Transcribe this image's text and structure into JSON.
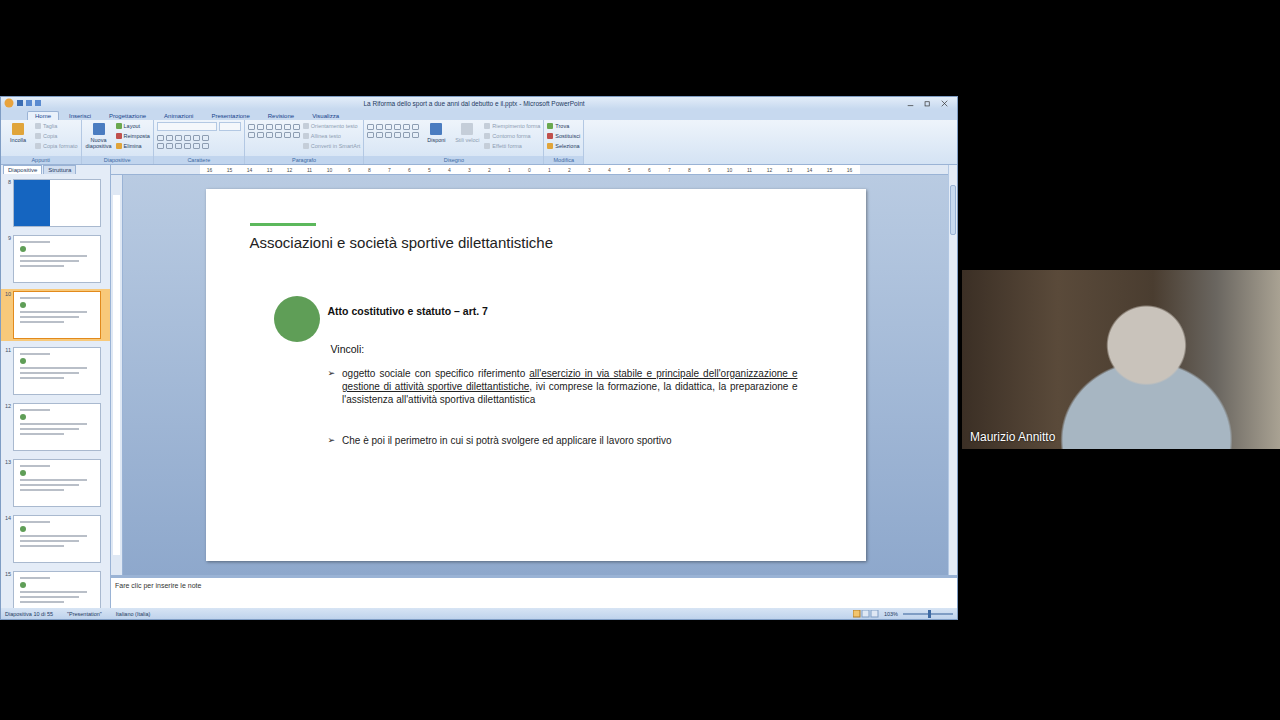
{
  "window": {
    "title": "La Riforma dello sport a due anni dal debutto e il.pptx - Microsoft PowerPoint"
  },
  "ribbon_tabs": [
    {
      "label": "Home",
      "selected": true
    },
    {
      "label": "Inserisci",
      "selected": false
    },
    {
      "label": "Progettazione",
      "selected": false
    },
    {
      "label": "Animazioni",
      "selected": false
    },
    {
      "label": "Presentazione",
      "selected": false
    },
    {
      "label": "Revisione",
      "selected": false
    },
    {
      "label": "Visualizza",
      "selected": false
    }
  ],
  "ribbon_groups": [
    {
      "label": "Appunti",
      "buttons": [
        {
          "label": "Incolla",
          "kind": "large",
          "disabled": false
        },
        {
          "label": "Taglia",
          "kind": "small",
          "disabled": true
        },
        {
          "label": "Copia",
          "kind": "small",
          "disabled": true
        },
        {
          "label": "Copia formato",
          "kind": "small",
          "disabled": true
        }
      ]
    },
    {
      "label": "Diapositive",
      "buttons": [
        {
          "label": "Nuova diapositiva",
          "kind": "large",
          "disabled": false
        },
        {
          "label": "Layout",
          "kind": "small",
          "disabled": false
        },
        {
          "label": "Reimposta",
          "kind": "small",
          "disabled": false
        },
        {
          "label": "Elimina",
          "kind": "small",
          "disabled": false
        }
      ]
    },
    {
      "label": "Carattere",
      "buttons": [
        {
          "label": "",
          "kind": "font",
          "disabled": true
        }
      ]
    },
    {
      "label": "Paragrafo",
      "buttons": [
        {
          "label": "",
          "kind": "para",
          "disabled": true
        },
        {
          "label": "Orientamento testo",
          "kind": "small",
          "disabled": true
        },
        {
          "label": "Allinea testo",
          "kind": "small",
          "disabled": true
        },
        {
          "label": "Converti in SmartArt",
          "kind": "small",
          "disabled": true
        }
      ]
    },
    {
      "label": "Disegno",
      "buttons": [
        {
          "label": "",
          "kind": "shapes",
          "disabled": false
        },
        {
          "label": "Disponi",
          "kind": "large",
          "disabled": false
        },
        {
          "label": "Stili veloci",
          "kind": "large",
          "disabled": true
        },
        {
          "label": "Riempimento forma",
          "kind": "small",
          "disabled": true
        },
        {
          "label": "Contorno forma",
          "kind": "small",
          "disabled": true
        },
        {
          "label": "Effetti forma",
          "kind": "small",
          "disabled": true
        }
      ]
    },
    {
      "label": "Modifica",
      "buttons": [
        {
          "label": "Trova",
          "kind": "small",
          "disabled": false
        },
        {
          "label": "Sostituisci",
          "kind": "small",
          "disabled": false
        },
        {
          "label": "Seleziona",
          "kind": "small",
          "disabled": false
        }
      ]
    }
  ],
  "pane_tabs": [
    {
      "label": "Diapositive",
      "selected": true
    },
    {
      "label": "Struttura",
      "selected": false
    }
  ],
  "thumbnails": [
    {
      "number": "8",
      "kind": "title",
      "selected": false
    },
    {
      "number": "9",
      "kind": "content",
      "selected": false
    },
    {
      "number": "10",
      "kind": "content",
      "selected": true
    },
    {
      "number": "11",
      "kind": "content",
      "selected": false
    },
    {
      "number": "12",
      "kind": "content",
      "selected": false
    },
    {
      "number": "13",
      "kind": "content",
      "selected": false
    },
    {
      "number": "14",
      "kind": "content",
      "selected": false
    },
    {
      "number": "15",
      "kind": "content",
      "selected": false
    }
  ],
  "ruler": [
    "16",
    "15",
    "14",
    "13",
    "12",
    "11",
    "10",
    "9",
    "8",
    "7",
    "6",
    "5",
    "4",
    "3",
    "2",
    "1",
    "0",
    "1",
    "2",
    "3",
    "4",
    "5",
    "6",
    "7",
    "8",
    "9",
    "10",
    "11",
    "12",
    "13",
    "14",
    "15",
    "16"
  ],
  "slide": {
    "title": "Associazioni e società sportive dilettantistiche",
    "heading": "Atto costitutivo  e statuto – art. 7",
    "subheading": "Vincoli:",
    "bullets": [
      {
        "marker": "➢",
        "segments": [
          {
            "text": "oggetto sociale con specifico riferimento ",
            "underline": false
          },
          {
            "text": "all'esercizio in via stabile e principale dell'organizzazione e gestione di attività sportive dilettantistiche",
            "underline": true
          },
          {
            "text": ", ivi comprese la formazione, la didattica, la preparazione e l'assistenza all'attività sportiva dilettantistica",
            "underline": false
          }
        ]
      },
      {
        "marker": "➢",
        "segments": [
          {
            "text": "Che è poi il perimetro in cui si potrà svolgere ed applicare il lavoro sportivo",
            "underline": false
          }
        ]
      }
    ]
  },
  "notes": {
    "placeholder": "Fare clic per inserire le note"
  },
  "status_bar": {
    "slide": "Diapositiva 10 di 55",
    "theme": "\"Presentation\"",
    "language": "Italiano (Italia)",
    "zoom": "103%",
    "zoom_level": 0.5
  },
  "webcam": {
    "name": "Maurizio Annitto"
  }
}
